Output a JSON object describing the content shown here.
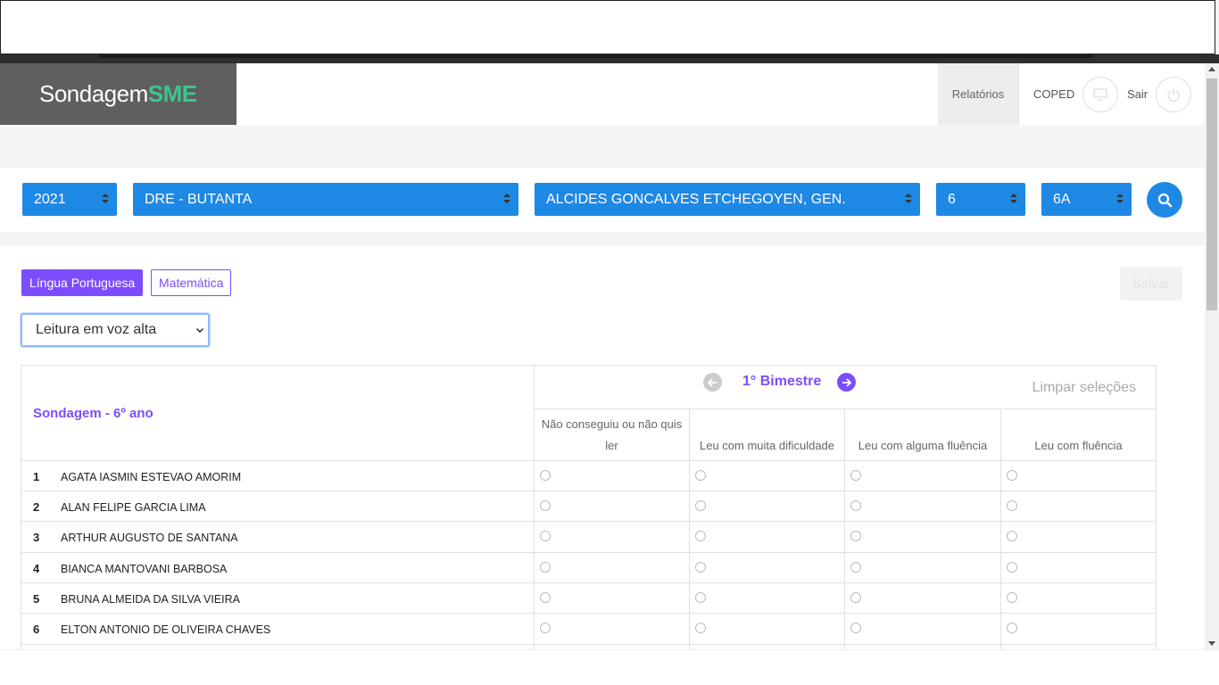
{
  "brand": {
    "part1": "Sondagem",
    "part2": "SME"
  },
  "nav": {
    "reports": "Relatórios",
    "user": "COPED",
    "logout": "Sair"
  },
  "filters": {
    "year": "2021",
    "dre": "DRE - BUTANTA",
    "school": "ALCIDES GONCALVES ETCHEGOYEN, GEN.",
    "grade": "6",
    "class": "6A"
  },
  "subjects": {
    "portuguese": "Língua Portuguesa",
    "math": "Matemática",
    "save": "Salvar"
  },
  "assessment_select": "Leitura em voz alta",
  "table": {
    "title": "Sondagem - 6º ano",
    "period": "1° Bimestre",
    "clear": "Limpar seleções",
    "columns": [
      "Não conseguiu ou não quis ler",
      "Leu com muita dificuldade",
      "Leu com alguma fluência",
      "Leu com fluência"
    ],
    "students": [
      {
        "num": "1",
        "name": "AGATA IASMIN ESTEVAO AMORIM"
      },
      {
        "num": "2",
        "name": "ALAN FELIPE GARCIA LIMA"
      },
      {
        "num": "3",
        "name": "ARTHUR AUGUSTO DE SANTANA"
      },
      {
        "num": "4",
        "name": "BIANCA MANTOVANI BARBOSA"
      },
      {
        "num": "5",
        "name": "BRUNA ALMEIDA DA SILVA VIEIRA"
      },
      {
        "num": "6",
        "name": "ELTON ANTONIO DE OLIVEIRA CHAVES"
      }
    ]
  },
  "colors": {
    "primary_blue": "#1e88e5",
    "purple": "#7c4dff",
    "green": "#3ec48e"
  }
}
